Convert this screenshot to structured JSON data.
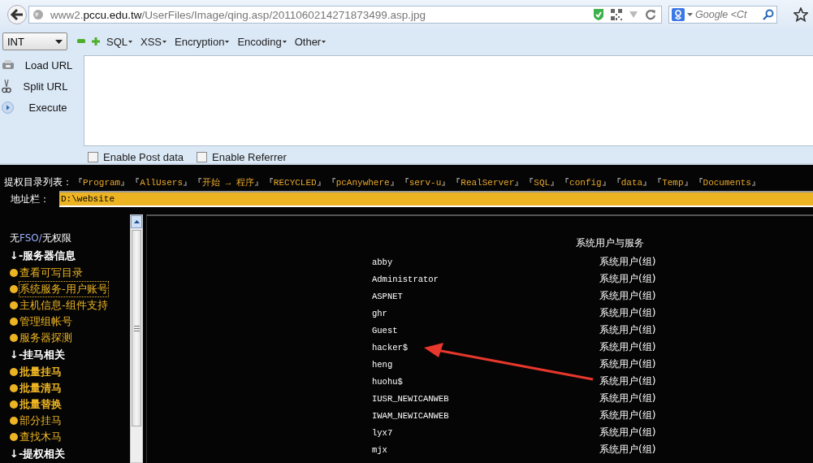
{
  "browser": {
    "url": {
      "prefix": "www2.",
      "domain": "pccu.edu.tw",
      "path": "/UserFiles/Image/qing.asp/2011060214271873499.asp.jpg"
    },
    "search": {
      "placeholder": "Google <Ct"
    }
  },
  "hackbar": {
    "select": "INT",
    "menus": [
      "SQL",
      "XSS",
      "Encryption",
      "Encoding",
      "Other"
    ],
    "actions": [
      {
        "kind": "load",
        "label": "Load URL"
      },
      {
        "kind": "split",
        "label": "Split URL"
      },
      {
        "kind": "execute",
        "label": "Execute"
      }
    ],
    "checkboxes": [
      {
        "label": "Enable Post data",
        "checked": false
      },
      {
        "label": "Enable Referrer",
        "checked": false
      }
    ]
  },
  "shell": {
    "dir_label": "提权目录列表：",
    "dirs": [
      {
        "open": "『",
        "name": "Program",
        "close": "』"
      },
      {
        "open": "『",
        "name": "AllUsers",
        "close": "』"
      },
      {
        "open": "『",
        "name": "开始 → 程序",
        "close": "』"
      },
      {
        "open": "『",
        "name": "RECYCLED",
        "close": "』"
      },
      {
        "open": "『",
        "name": "pcAnywhere",
        "close": "』"
      },
      {
        "open": "『",
        "name": "serv-u",
        "close": "』"
      },
      {
        "open": "『",
        "name": "RealServer",
        "close": "』"
      },
      {
        "open": "『",
        "name": "SQL",
        "close": "』"
      },
      {
        "open": "『",
        "name": "config",
        "close": "』"
      },
      {
        "open": "『",
        "name": "data",
        "close": "』"
      },
      {
        "open": "『",
        "name": "Temp",
        "close": "』"
      },
      {
        "open": "『",
        "name": "Documents",
        "close": "』"
      }
    ],
    "address_label": "地址栏：",
    "address": "D:\\website",
    "sidebar": [
      {
        "kind": "note",
        "parts": [
          "无",
          "FSO/",
          "无权限"
        ]
      },
      {
        "kind": "heading",
        "text": "↓-服务器信息"
      },
      {
        "kind": "link",
        "text": "查看可写目录",
        "bold": false,
        "selected": false
      },
      {
        "kind": "link",
        "text": "系统服务-用户账号",
        "bold": false,
        "selected": true
      },
      {
        "kind": "link",
        "text": "主机信息-组件支持",
        "bold": false,
        "selected": false
      },
      {
        "kind": "link",
        "text": "管理组帐号",
        "bold": false,
        "selected": false
      },
      {
        "kind": "link",
        "text": "服务器探测",
        "bold": false,
        "selected": false
      },
      {
        "kind": "heading",
        "text": "↓-挂马相关"
      },
      {
        "kind": "link",
        "text": "批量挂马",
        "bold": true,
        "selected": false
      },
      {
        "kind": "link",
        "text": "批量清马",
        "bold": true,
        "selected": false
      },
      {
        "kind": "link",
        "text": "批量替换",
        "bold": true,
        "selected": false
      },
      {
        "kind": "link",
        "text": "部分挂马",
        "bold": false,
        "selected": false
      },
      {
        "kind": "link",
        "text": "查找木马",
        "bold": false,
        "selected": false
      },
      {
        "kind": "heading",
        "text": "↓-提权相关"
      }
    ],
    "table": {
      "header": "系统用户与服务",
      "rows": [
        {
          "name": "abby",
          "type": "系统用户(组)"
        },
        {
          "name": "Administrator",
          "type": "系统用户(组)"
        },
        {
          "name": "ASPNET",
          "type": "系统用户(组)"
        },
        {
          "name": "ghr",
          "type": "系统用户(组)"
        },
        {
          "name": "Guest",
          "type": "系统用户(组)"
        },
        {
          "name": "hacker$",
          "type": "系统用户(组)"
        },
        {
          "name": "heng",
          "type": "系统用户(组)"
        },
        {
          "name": "huohu$",
          "type": "系统用户(组)"
        },
        {
          "name": "IUSR_NEWICANWEB",
          "type": "系统用户(组)"
        },
        {
          "name": "IWAM_NEWICANWEB",
          "type": "系统用户(组)"
        },
        {
          "name": "lyx7",
          "type": "系统用户(组)"
        },
        {
          "name": "mjx",
          "type": "系统用户(组)"
        }
      ]
    }
  }
}
